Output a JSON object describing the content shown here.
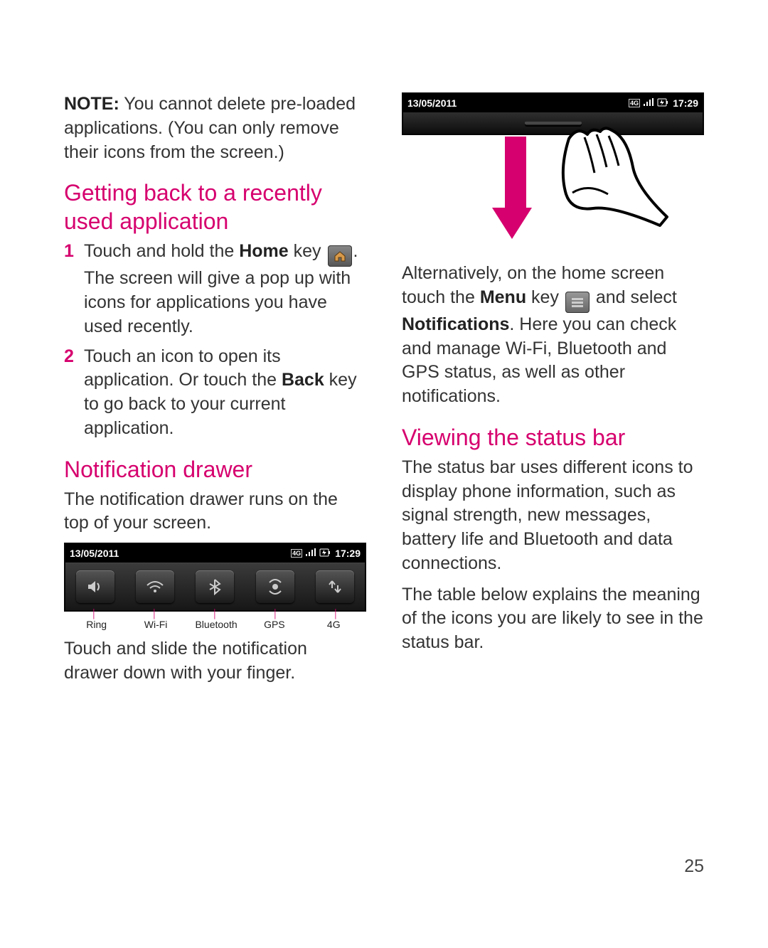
{
  "page_number": "25",
  "note": {
    "label": "NOTE:",
    "text": " You cannot delete pre-loaded applications. (You can only remove their icons from the screen.)"
  },
  "headings": {
    "h1": "Getting back to a recently used application",
    "h2": "Notification drawer",
    "h3": "Viewing the status bar"
  },
  "steps": {
    "s1a": "Touch and hold the ",
    "s1_home": "Home",
    "s1b": " key ",
    "s1c": ". The screen will give a pop up with icons for applications you have used recently.",
    "s2a": "Touch an icon to open its application. Or touch the ",
    "s2_back": "Back",
    "s2b": " key to go back to your current application."
  },
  "drawer_intro": "The notification drawer runs on the top of your screen.",
  "drawer_outro": "Touch and slide the notification drawer down with your finger.",
  "quick_labels": {
    "ring": "Ring",
    "wifi": "Wi-Fi",
    "bt": "Bluetooth",
    "gps": "GPS",
    "fourg": "4G"
  },
  "status_bar": {
    "date": "13/05/2011",
    "time": "17:29",
    "fourg_badge": "4G"
  },
  "alt_text": {
    "a": "Alternatively, on the home screen touch the ",
    "menu": "Menu",
    "b": " key ",
    "c": " and select ",
    "notifications": "Notifications",
    "d": ". Here you can check and manage Wi-Fi, Bluetooth and GPS status, as well as other notifications."
  },
  "viewing_p1": "The status bar uses different icons to display phone information, such as signal strength, new messages, battery life and Bluetooth and data connections.",
  "viewing_p2": "The table below explains the meaning of the icons you are likely to see in the status bar."
}
